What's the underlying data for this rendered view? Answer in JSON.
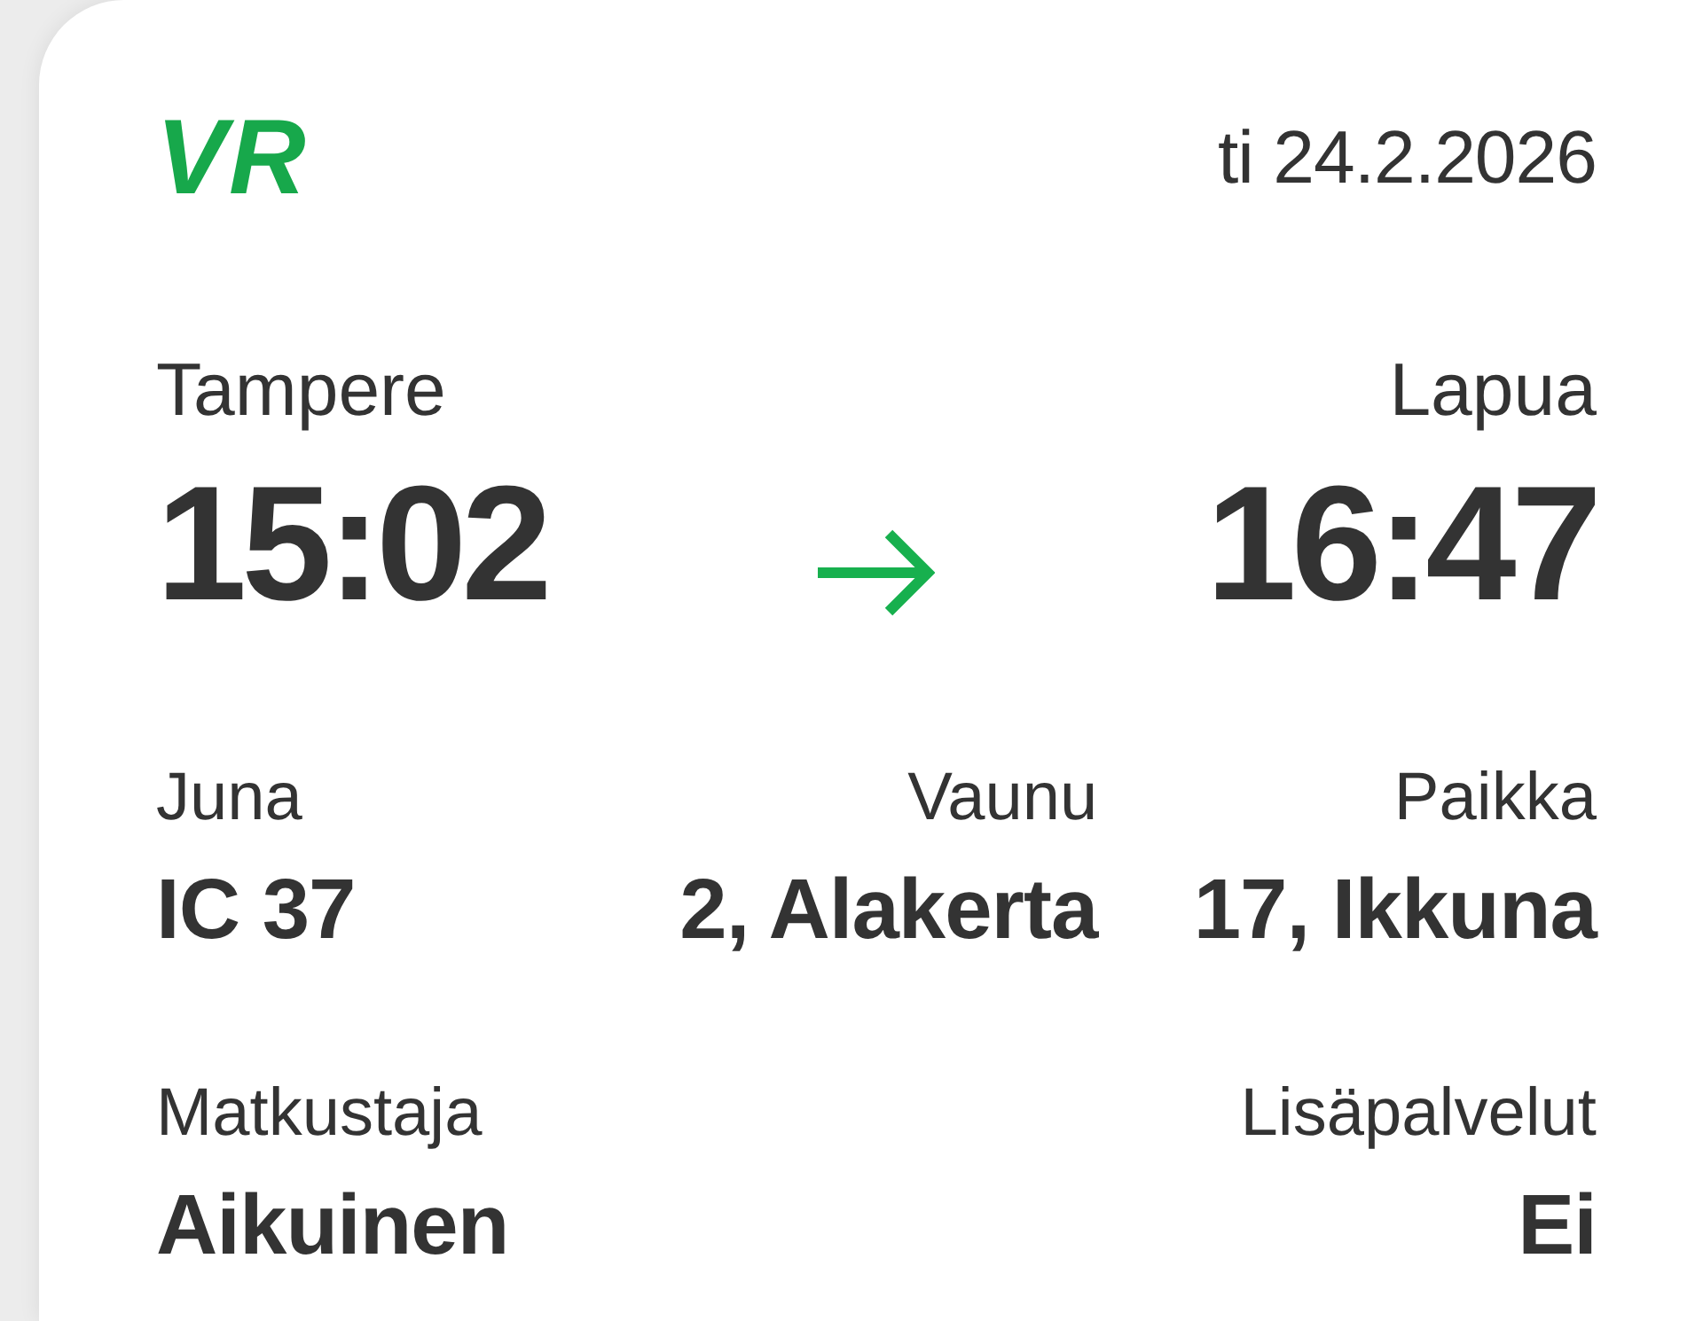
{
  "header": {
    "logo": "VR",
    "date": "ti 24.2.2026"
  },
  "journey": {
    "departure": {
      "station": "Tampere",
      "time": "15:02"
    },
    "arrival": {
      "station": "Lapua",
      "time": "16:47"
    }
  },
  "detail_rows": [
    [
      {
        "label": "Juna",
        "value": "IC 37"
      },
      {
        "label": "Vaunu",
        "value": "2, Alakerta"
      },
      {
        "label": "Paikka",
        "value": "17, Ikkuna"
      }
    ],
    [
      {
        "label": "Matkustaja",
        "value": "Aikuinen"
      },
      {
        "label": "Lisäpalvelut",
        "value": "Ei"
      }
    ]
  ]
}
